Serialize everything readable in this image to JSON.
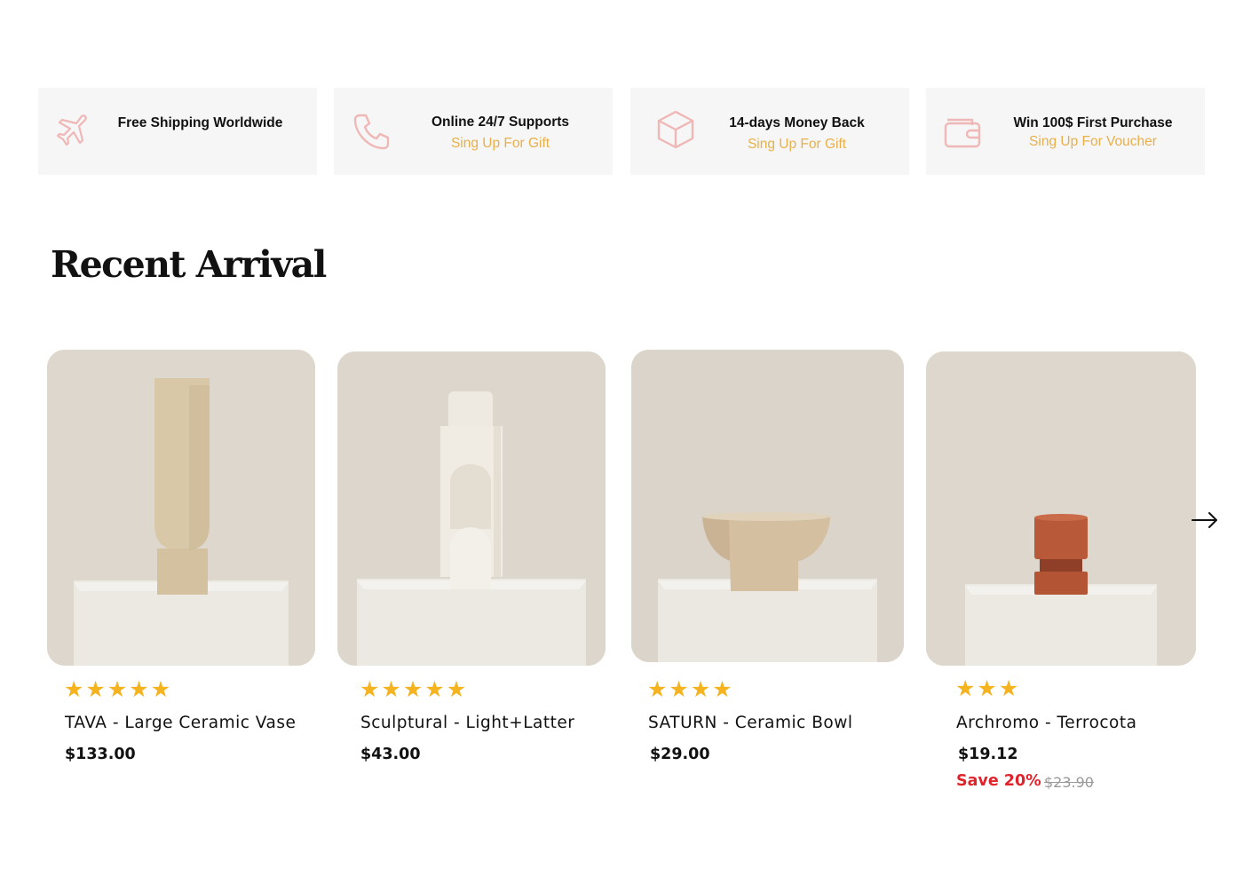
{
  "features": [
    {
      "title": "Free Shipping Worldwide",
      "subtitle": "",
      "icon": "airplane-icon"
    },
    {
      "title": "Online 24/7 Supports",
      "subtitle": "Sing Up For Gift",
      "icon": "phone-icon"
    },
    {
      "title": "14-days Money Back",
      "subtitle": "Sing Up For Gift",
      "icon": "box-icon"
    },
    {
      "title": "Win 100$  First Purchase",
      "subtitle": "Sing Up For Voucher",
      "icon": "wallet-icon"
    }
  ],
  "colors": {
    "icon_accent": "#f0b7b7",
    "subtitle_accent": "#e8b04b",
    "star": "#f5b320",
    "sale": "#e0242b",
    "feature_bg": "#f6f6f6"
  },
  "section": {
    "title": "Recent Arrival"
  },
  "products": [
    {
      "name": "TAVA - Large Ceramic Vase",
      "rating": 5,
      "price": "$133.00"
    },
    {
      "name": "Sculptural - Light+Latter",
      "rating": 5,
      "price": "$43.00"
    },
    {
      "name": "SATURN - Ceramic Bowl",
      "rating": 4,
      "price": "$29.00"
    },
    {
      "name": "Archromo - Terrocota",
      "rating": 3,
      "price": "$19.12",
      "save_label": "Save 20%",
      "old_price": "$23.90"
    }
  ],
  "carousel": {
    "next_icon": "arrow-right-icon"
  }
}
